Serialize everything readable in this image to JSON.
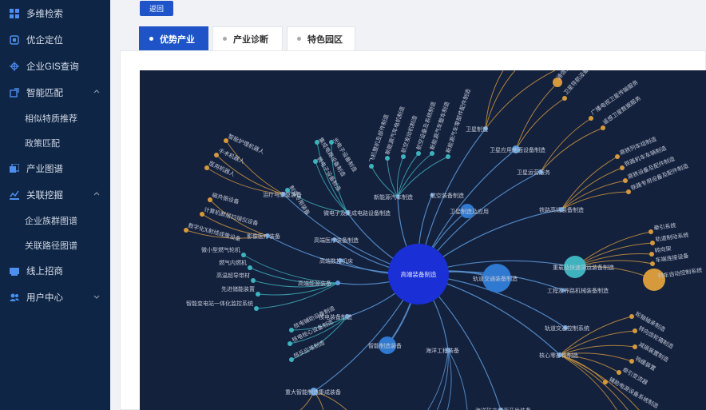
{
  "sidebar": {
    "items": [
      {
        "label": "多维检索",
        "icon": "grid-icon"
      },
      {
        "label": "优企定位",
        "icon": "target-icon"
      },
      {
        "label": "企业GIS查询",
        "icon": "crosshair-icon"
      },
      {
        "label": "智能匹配",
        "icon": "share-icon",
        "expanded": true,
        "children": [
          {
            "label": "相似特质推荐"
          },
          {
            "label": "政策匹配"
          }
        ]
      },
      {
        "label": "产业图谱",
        "icon": "layers-icon"
      },
      {
        "label": "关联挖掘",
        "icon": "chart-icon",
        "expanded": true,
        "children": [
          {
            "label": "企业族群图谱"
          },
          {
            "label": "关联路径图谱"
          }
        ]
      },
      {
        "label": "线上招商",
        "icon": "flag-icon"
      },
      {
        "label": "用户中心",
        "icon": "users-icon",
        "expanded": false
      }
    ]
  },
  "back_label": "返回",
  "tabs": [
    {
      "label": "优势产业",
      "active": true
    },
    {
      "label": "产业诊断",
      "active": false
    },
    {
      "label": "特色园区",
      "active": false
    }
  ],
  "graph": {
    "colors": {
      "background": "#14213d",
      "center": "#1a2fd6",
      "hub": "#2f79d0",
      "teal": "#3fb3bd",
      "gold": "#d69a3c",
      "link": "#5e9ee0",
      "link_gold": "#d39a3e"
    },
    "center": {
      "label": "高端装备制造"
    },
    "hubs": [
      {
        "label": "新能源汽车制造"
      },
      {
        "label": "航空装备制造"
      },
      {
        "label": "卫星制造"
      },
      {
        "label": "卫星应用地面设备制造"
      },
      {
        "label": "卫星运营服务"
      },
      {
        "label": "卫星制造及应用"
      },
      {
        "label": "铁路高端装备制造"
      },
      {
        "label": "轨道交通装备制造"
      },
      {
        "label": "重载及快速货运装备制造"
      },
      {
        "label": "工程及养路机械装备制造"
      },
      {
        "label": "轨道交通控制系统"
      },
      {
        "label": "核心零部件制造"
      },
      {
        "label": "海洋工程装备"
      },
      {
        "label": "智能制造装备"
      },
      {
        "label": "核电装备制造"
      },
      {
        "label": "高端能源装备"
      },
      {
        "label": "高端数控机床"
      },
      {
        "label": "高端医疗装备制造"
      },
      {
        "label": "影像医疗装备"
      },
      {
        "label": "治疗与康复装备"
      },
      {
        "label": "微电子及集成电路设备制造"
      },
      {
        "label": "重大智能制造集成装备"
      },
      {
        "label": "海洋矿产资源开发装备"
      }
    ],
    "leaves": {
      "aviation": [
        "飞机整机及部件制造",
        "新能源汽车电机制造",
        "航空发动机制造",
        "航空设备及系统制造",
        "新能源汽车整车制造",
        "新能源汽车零部件配件制造"
      ],
      "microelectronics": [
        "集成电路设备制造",
        "光电子设备制造",
        "微电子设备制造",
        "制造专用装备"
      ],
      "medical": [
        "智能护理机器人",
        "手术机器人",
        "医用机器人"
      ],
      "imaging": [
        "磁共振设备",
        "计算机断层扫描仪设备",
        "数字化X射线成像设备"
      ],
      "satellite_ground": [
        "通信卫星系统",
        "卫星导航设备制造"
      ],
      "satellite_service": [
        "广播电视卫星传输服务",
        "遥感卫星数据服务"
      ],
      "railway": [
        "高铁列车组制造",
        "铁路机车车辆制造",
        "高铁设备及配件制造",
        "铁路专用设备及配件制造"
      ],
      "freight": [
        "牵引系统",
        "轨道制动系统",
        "转向架",
        "车端连接设备",
        "列车自动控制系统"
      ],
      "core_parts": [
        "轮轴轴承制造",
        "转向齿轮箱制造",
        "减振装置制造",
        "钩缓装置",
        "牵引变流器",
        "辅助电源设备系统制造"
      ],
      "energy": [
        "微小型燃气轮机",
        "燃气内燃机",
        "高温超导带材",
        "先进储能装置",
        "智能变电站一体化监控系统"
      ],
      "nuclear": [
        "核电辅助设备制造",
        "核电核心设备制造",
        "核反应堆制造"
      ]
    }
  }
}
